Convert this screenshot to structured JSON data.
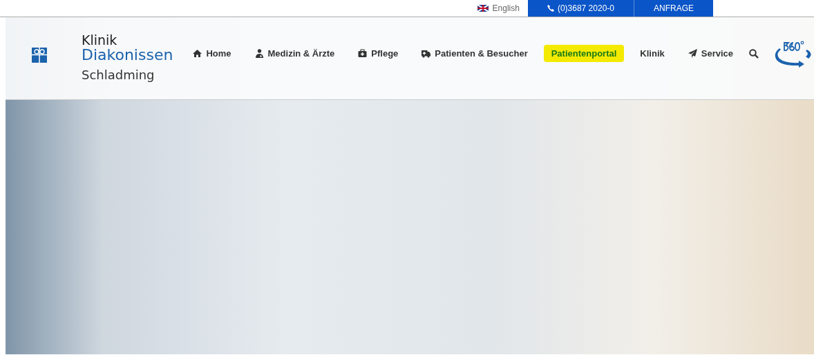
{
  "top_bar": {
    "language": "English",
    "phone": "(0)3687 2020-0",
    "request_button": "ANFRAGE"
  },
  "logo": {
    "line_1": "Klinik",
    "line_2": "Diakonissen",
    "line_3": "Schladming"
  },
  "nav": [
    {
      "label": "Home",
      "highlighted": false
    },
    {
      "label": "Medizin & Ärzte",
      "highlighted": false
    },
    {
      "label": "Pflege",
      "highlighted": false
    },
    {
      "label": "Patienten & Besucher",
      "highlighted": false
    },
    {
      "label": "Patientenportal",
      "highlighted": true
    },
    {
      "label": "Klinik",
      "highlighted": false
    },
    {
      "label": "Service",
      "highlighted": false
    }
  ]
}
